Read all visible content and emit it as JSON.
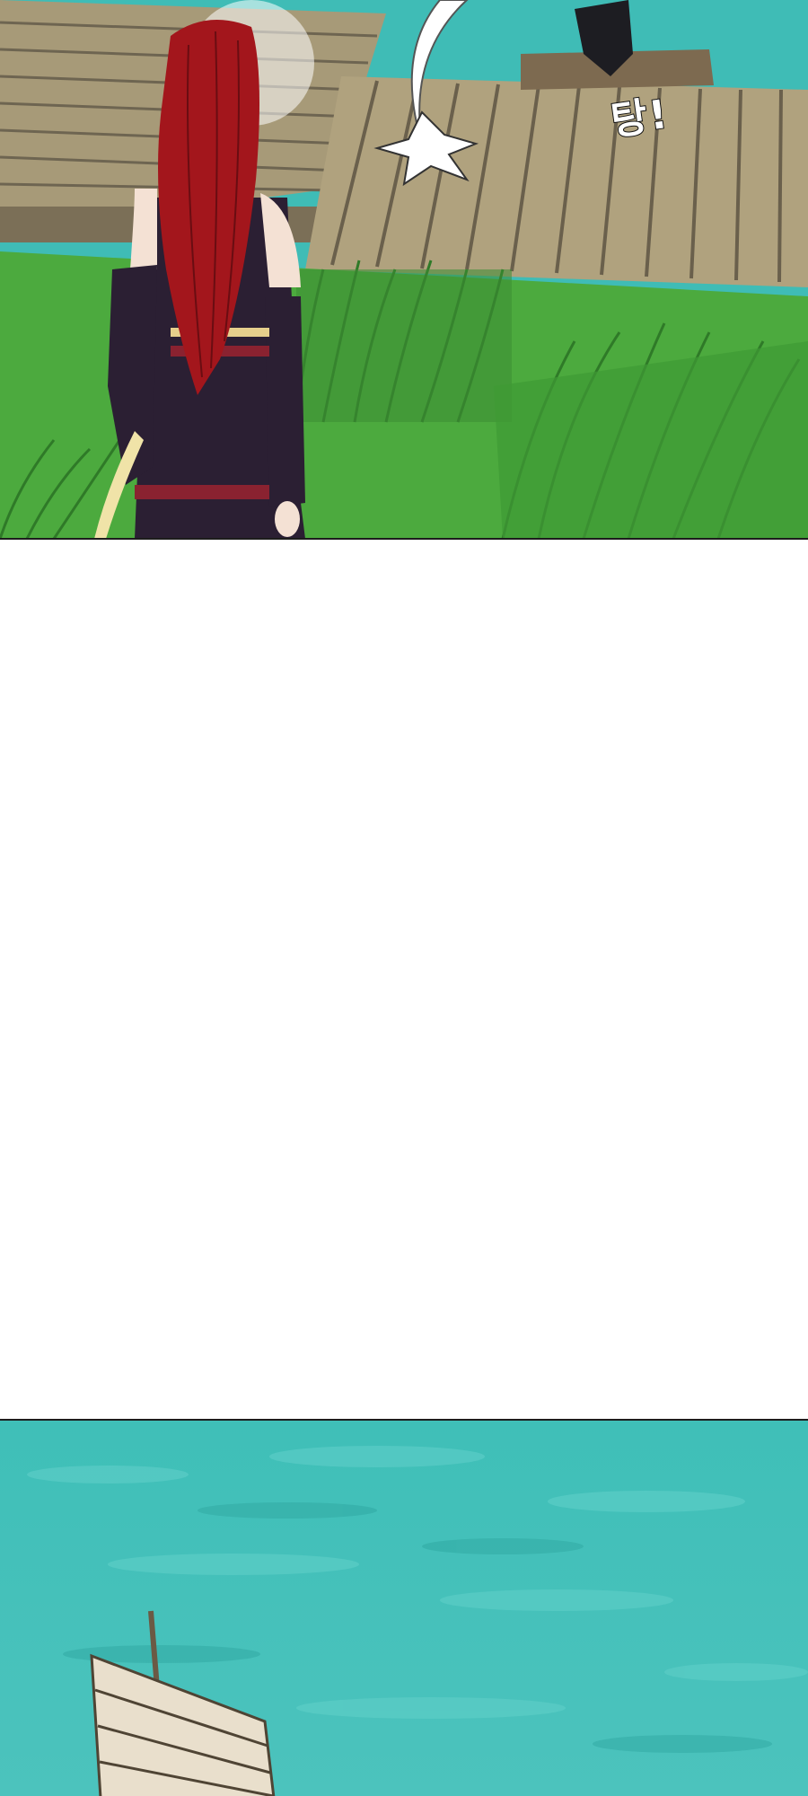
{
  "panels": [
    {
      "id": "top",
      "sound_effect": "탕!"
    },
    {
      "id": "gutter"
    },
    {
      "id": "bottom"
    }
  ],
  "colors": {
    "water": "#3fbcb6",
    "dock_wood": "#a79a78",
    "grass": "#4caa3e",
    "hair": "#a3161c",
    "outfit": "#2b1f33",
    "sail": "#e9dfcc"
  }
}
